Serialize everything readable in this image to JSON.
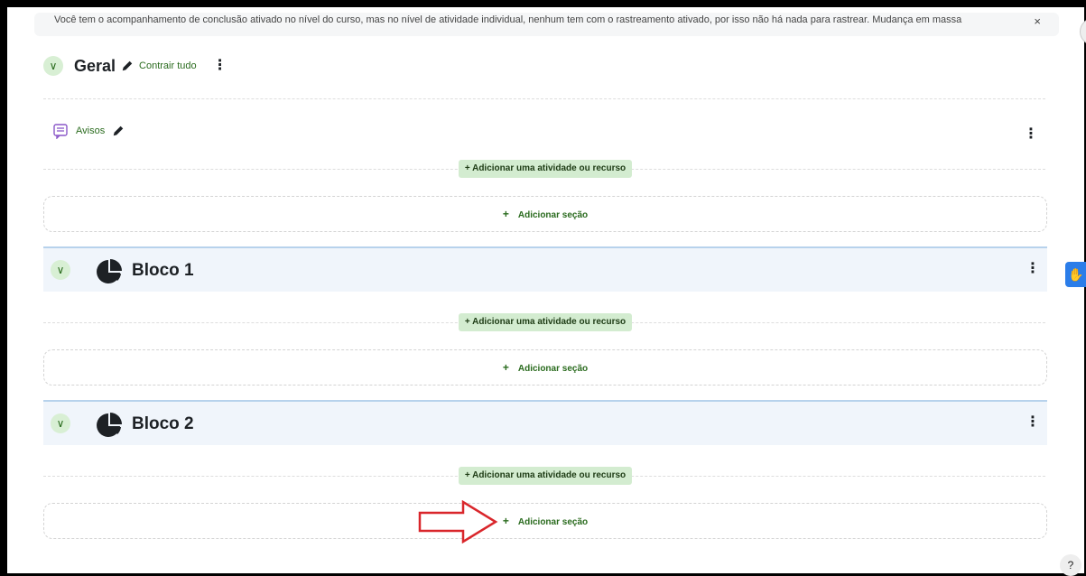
{
  "notice": {
    "text": "Você tem o acompanhamento de conclusão ativado no nível do curso, mas no nível de atividade individual, nenhum tem com o rastreamento ativado, por isso não há nada para rastrear. Mudança em massa",
    "close": "×"
  },
  "general": {
    "title": "Geral",
    "collapse_link": "Contrair tudo",
    "menu": "⋮"
  },
  "activity": {
    "label": "Avisos",
    "menu": "⋮"
  },
  "add_activity_label": "+ Adicionar uma atividade ou recurso",
  "add_section": {
    "plus": "+",
    "label": "Adicionar seção"
  },
  "sections": [
    {
      "title": "Bloco 1",
      "menu": "⋮"
    },
    {
      "title": "Bloco 2",
      "menu": "⋮"
    }
  ],
  "help": "?",
  "accessibility_icon": "sign-language-icon",
  "colors": {
    "accent": "#2a6b1e",
    "add_bg": "#d3ecd0",
    "section_bg": "#f0f5fb",
    "arrow": "#d9262b"
  }
}
